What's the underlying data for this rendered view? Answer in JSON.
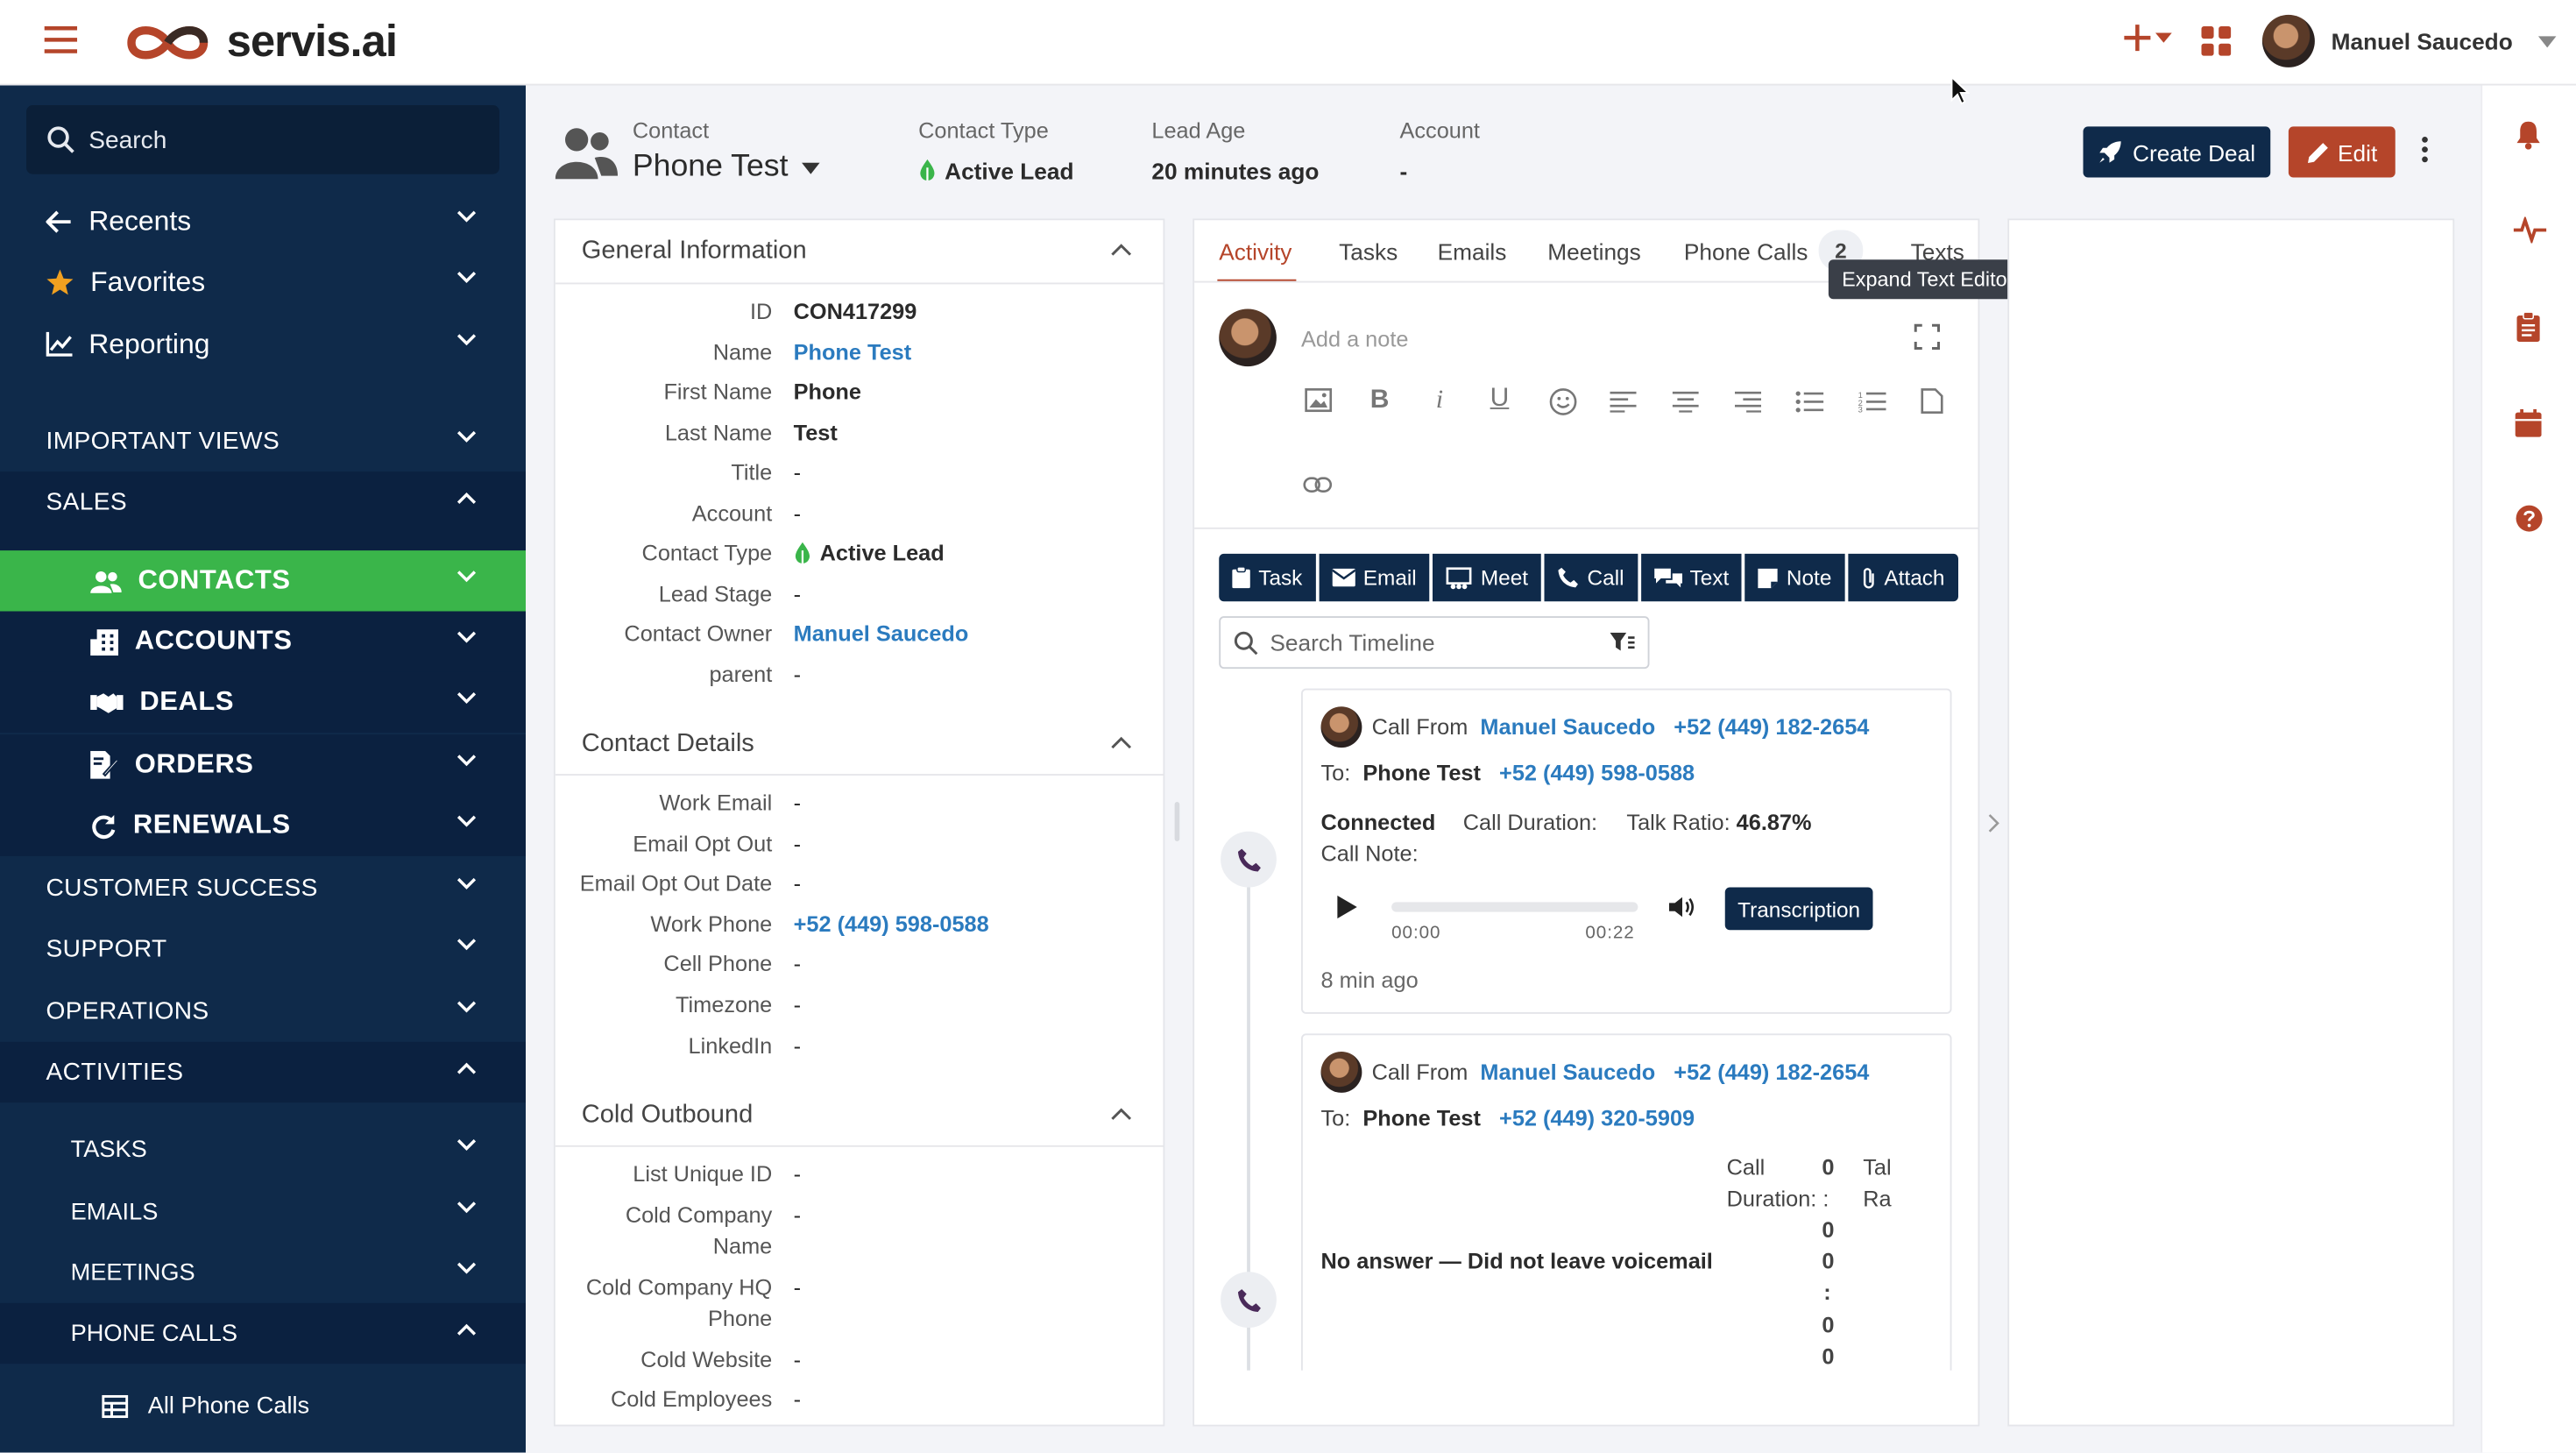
{
  "brand": {
    "logo_text": "servis.ai"
  },
  "topbar": {
    "user_name": "Manuel Saucedo"
  },
  "sidebar": {
    "search_placeholder": "Search",
    "top_items": [
      {
        "label": "Recents"
      },
      {
        "label": "Favorites"
      },
      {
        "label": "Reporting"
      }
    ],
    "sections": [
      {
        "label": "IMPORTANT VIEWS"
      },
      {
        "label": "SALES"
      },
      {
        "label": "CUSTOMER SUCCESS"
      },
      {
        "label": "SUPPORT"
      },
      {
        "label": "OPERATIONS"
      },
      {
        "label": "ACTIVITIES"
      }
    ],
    "sales_items": [
      {
        "label": "CONTACTS"
      },
      {
        "label": "ACCOUNTS"
      },
      {
        "label": "DEALS"
      },
      {
        "label": "ORDERS"
      },
      {
        "label": "RENEWALS"
      }
    ],
    "activity_items": [
      {
        "label": "TASKS"
      },
      {
        "label": "EMAILS"
      },
      {
        "label": "MEETINGS"
      },
      {
        "label": "PHONE CALLS"
      }
    ],
    "all_phone_calls": "All Phone Calls"
  },
  "header": {
    "contact_label": "Contact",
    "contact_name": "Phone Test",
    "contact_type_label": "Contact Type",
    "contact_type_value": "Active Lead",
    "lead_age_label": "Lead Age",
    "lead_age_value": "20 minutes ago",
    "account_label": "Account",
    "account_value": "-",
    "create_deal": "Create Deal",
    "edit": "Edit"
  },
  "general_info": {
    "title": "General Information",
    "fields": [
      {
        "k": "ID",
        "v": "CON417299"
      },
      {
        "k": "Name",
        "v": "Phone Test"
      },
      {
        "k": "First Name",
        "v": "Phone"
      },
      {
        "k": "Last Name",
        "v": "Test"
      },
      {
        "k": "Title",
        "v": "-"
      },
      {
        "k": "Account",
        "v": "-"
      },
      {
        "k": "Contact Type",
        "v": "Active Lead"
      },
      {
        "k": "Lead Stage",
        "v": "-"
      },
      {
        "k": "Contact Owner",
        "v": "Manuel Saucedo"
      },
      {
        "k": "parent",
        "v": "-"
      }
    ]
  },
  "contact_details": {
    "title": "Contact Details",
    "fields": [
      {
        "k": "Work Email",
        "v": "-"
      },
      {
        "k": "Email Opt Out",
        "v": "-"
      },
      {
        "k": "Email Opt Out Date",
        "v": "-"
      },
      {
        "k": "Work Phone",
        "v": "+52 (449) 598-0588"
      },
      {
        "k": "Cell Phone",
        "v": "-"
      },
      {
        "k": "Timezone",
        "v": "-"
      },
      {
        "k": "LinkedIn",
        "v": "-"
      }
    ]
  },
  "cold_outbound": {
    "title": "Cold Outbound",
    "fields": [
      {
        "k": "List Unique ID",
        "v": "-"
      },
      {
        "k1": "Cold Company",
        "k2": "Name",
        "v": "-"
      },
      {
        "k1": "Cold Company HQ",
        "k2": "Phone",
        "v": "-"
      },
      {
        "k": "Cold Website",
        "v": "-"
      },
      {
        "k": "Cold Employees",
        "v": "-"
      }
    ]
  },
  "activity": {
    "tabs": [
      "Activity",
      "Tasks",
      "Emails",
      "Meetings",
      "Phone Calls",
      "Texts"
    ],
    "phone_calls_count": "2",
    "tooltip": "Expand Text Editor",
    "note_placeholder": "Add a note",
    "action_buttons": [
      "Task",
      "Email",
      "Meet",
      "Call",
      "Text",
      "Note",
      "Attach"
    ],
    "search_placeholder": "Search Timeline"
  },
  "timeline": [
    {
      "call_from_label": "Call From",
      "from_name": "Manuel Saucedo",
      "from_phone": "+52 (449) 182-2654",
      "to_label": "To:",
      "to_name": "Phone Test",
      "to_phone": "+52 (449) 598-0588",
      "status": "Connected",
      "duration_label": "Call Duration:",
      "talk_ratio_label": "Talk Ratio:",
      "talk_ratio": "46.87%",
      "call_note_label": "Call Note:",
      "time_start": "00:00",
      "time_end": "00:22",
      "transcription": "Transcription",
      "ago": "8 min ago"
    },
    {
      "call_from_label": "Call From",
      "from_name": "Manuel Saucedo",
      "from_phone": "+52 (449) 182-2654",
      "to_label": "To:",
      "to_name": "Phone Test",
      "to_phone": "+52 (449) 320-5909",
      "outcome": "No answer — Did not leave voicemail",
      "duration_label_1": "Call",
      "duration_label_2": "Duration: :",
      "duration_digits": [
        "0",
        "0",
        "0",
        ":",
        "0",
        "0"
      ],
      "talk_label_1": "Tal",
      "talk_label_2": "Ra"
    }
  ],
  "colors": {
    "sidebar_bg": "#0f2a4a",
    "active_green": "#3ab54a",
    "accent": "#b5452a",
    "link": "#2b7bbf"
  }
}
